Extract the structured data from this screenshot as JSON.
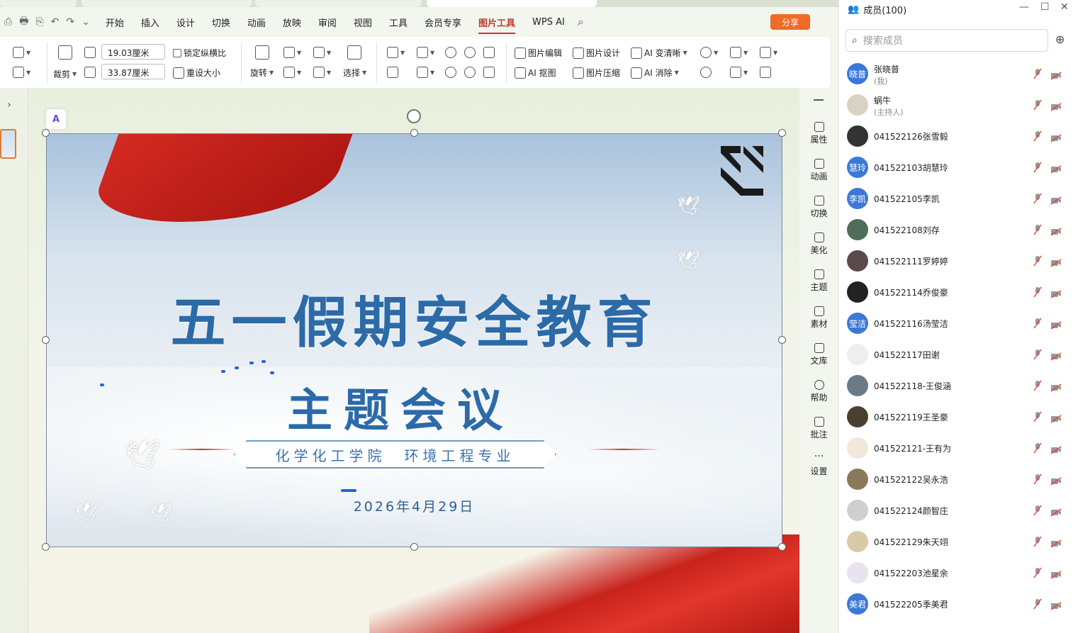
{
  "menu": {
    "items": [
      "开始",
      "插入",
      "设计",
      "切换",
      "动画",
      "放映",
      "审阅",
      "视图",
      "工具",
      "会员专享",
      "图片工具",
      "WPS AI"
    ],
    "active": "图片工具",
    "share": "分享"
  },
  "ribbon": {
    "width_value": "19.03厘米",
    "height_value": "33.87厘米",
    "lock_ratio": "锁定纵横比",
    "reset_size": "重设大小",
    "crop": "裁剪",
    "rotate": "旋转",
    "select": "选择",
    "edit": "图片编辑",
    "design": "图片设计",
    "sharpen": "AI 变清晰",
    "ai_cutout": "AI 抠图",
    "compress": "图片压缩",
    "ai_erase": "AI 消除"
  },
  "sidebar": [
    "属性",
    "动画",
    "切换",
    "美化",
    "主题",
    "素材",
    "文库",
    "帮助",
    "批注",
    "设置"
  ],
  "slide": {
    "title": "五一假期安全教育",
    "subtitle": "主题会议",
    "banner": "化学化工学院　环境工程专业",
    "date": "2026年4月29日"
  },
  "panel": {
    "title": "成员(100)",
    "search_placeholder": "搜索成员",
    "members": [
      {
        "name": "张晓普",
        "sub": "(我)",
        "avatar": "晓普",
        "color": "#3b78d8"
      },
      {
        "name": "蜗牛",
        "sub": "(主持人)",
        "avatar": "",
        "color": "#d9d2c2"
      },
      {
        "name": "041522126张雪毅",
        "sub": "",
        "avatar": "",
        "color": "#333"
      },
      {
        "name": "041522103胡慧玲",
        "sub": "",
        "avatar": "慧玲",
        "color": "#3b78d8"
      },
      {
        "name": "041522105李凯",
        "sub": "",
        "avatar": "李凯",
        "color": "#3b78d8"
      },
      {
        "name": "041522108刘存",
        "sub": "",
        "avatar": "",
        "color": "#4e6e5a"
      },
      {
        "name": "041522111罗婷婷",
        "sub": "",
        "avatar": "",
        "color": "#5a4a4a"
      },
      {
        "name": "041522114乔俊豪",
        "sub": "",
        "avatar": "",
        "color": "#222"
      },
      {
        "name": "041522116汤莹洁",
        "sub": "",
        "avatar": "莹洁",
        "color": "#3b78d8"
      },
      {
        "name": "041522117田谢",
        "sub": "",
        "avatar": "",
        "color": "#eee"
      },
      {
        "name": "041522118-王俊涵",
        "sub": "",
        "avatar": "",
        "color": "#6a7a86"
      },
      {
        "name": "041522119王圣豪",
        "sub": "",
        "avatar": "",
        "color": "#4a3f30"
      },
      {
        "name": "041522121-王有为",
        "sub": "",
        "avatar": "",
        "color": "#f2e7da"
      },
      {
        "name": "041522122吴永浩",
        "sub": "",
        "avatar": "",
        "color": "#8a7a5a"
      },
      {
        "name": "041522124颜智庄",
        "sub": "",
        "avatar": "",
        "color": "#cfcfcf"
      },
      {
        "name": "041522129朱天翊",
        "sub": "",
        "avatar": "",
        "color": "#d8c9a8"
      },
      {
        "name": "041522203池星余",
        "sub": "",
        "avatar": "",
        "color": "#e9e2ef"
      },
      {
        "name": "041522205季美君",
        "sub": "",
        "avatar": "美君",
        "color": "#3b78d8"
      }
    ]
  }
}
